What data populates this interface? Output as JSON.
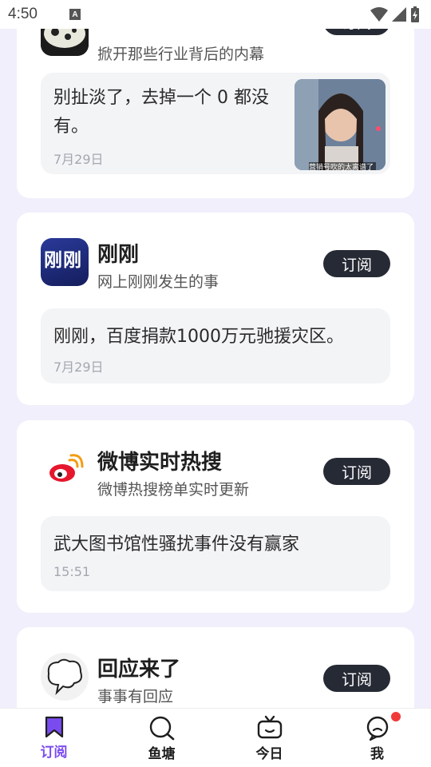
{
  "status_bar": {
    "time": "4:50",
    "a_badge": "A"
  },
  "cards": [
    {
      "desc": "掀开那些行业背后的内幕",
      "subscribe": "订阅",
      "post": {
        "title": "别扯淡了，去掉一个 0 都没有。",
        "date": "7月29日",
        "thumb_caption": "营销号吹的太离谱了"
      }
    },
    {
      "name": "刚刚",
      "desc": "网上刚刚发生的事",
      "subscribe": "订阅",
      "avatar_text": "刚刚",
      "post": {
        "title": "刚刚，百度捐款1000万元驰援灾区。",
        "date": "7月29日"
      }
    },
    {
      "name": "微博实时热搜",
      "desc": "微博热搜榜单实时更新",
      "subscribe": "订阅",
      "post": {
        "title": "武大图书馆性骚扰事件没有赢家",
        "date": "15:51"
      }
    },
    {
      "name": "回应来了",
      "desc": "事事有回应",
      "subscribe": "订阅"
    }
  ],
  "tabs": [
    {
      "label": "订阅",
      "icon": "bookmark-icon",
      "active": true
    },
    {
      "label": "鱼塘",
      "icon": "search-icon"
    },
    {
      "label": "今日",
      "icon": "tv-icon"
    },
    {
      "label": "我",
      "icon": "chat-bubble-icon",
      "badge": true
    }
  ],
  "colors": {
    "accent": "#7a4cf0",
    "button_bg": "#262a34",
    "page_bg": "#f1effb",
    "notification": "#f03a3a"
  }
}
